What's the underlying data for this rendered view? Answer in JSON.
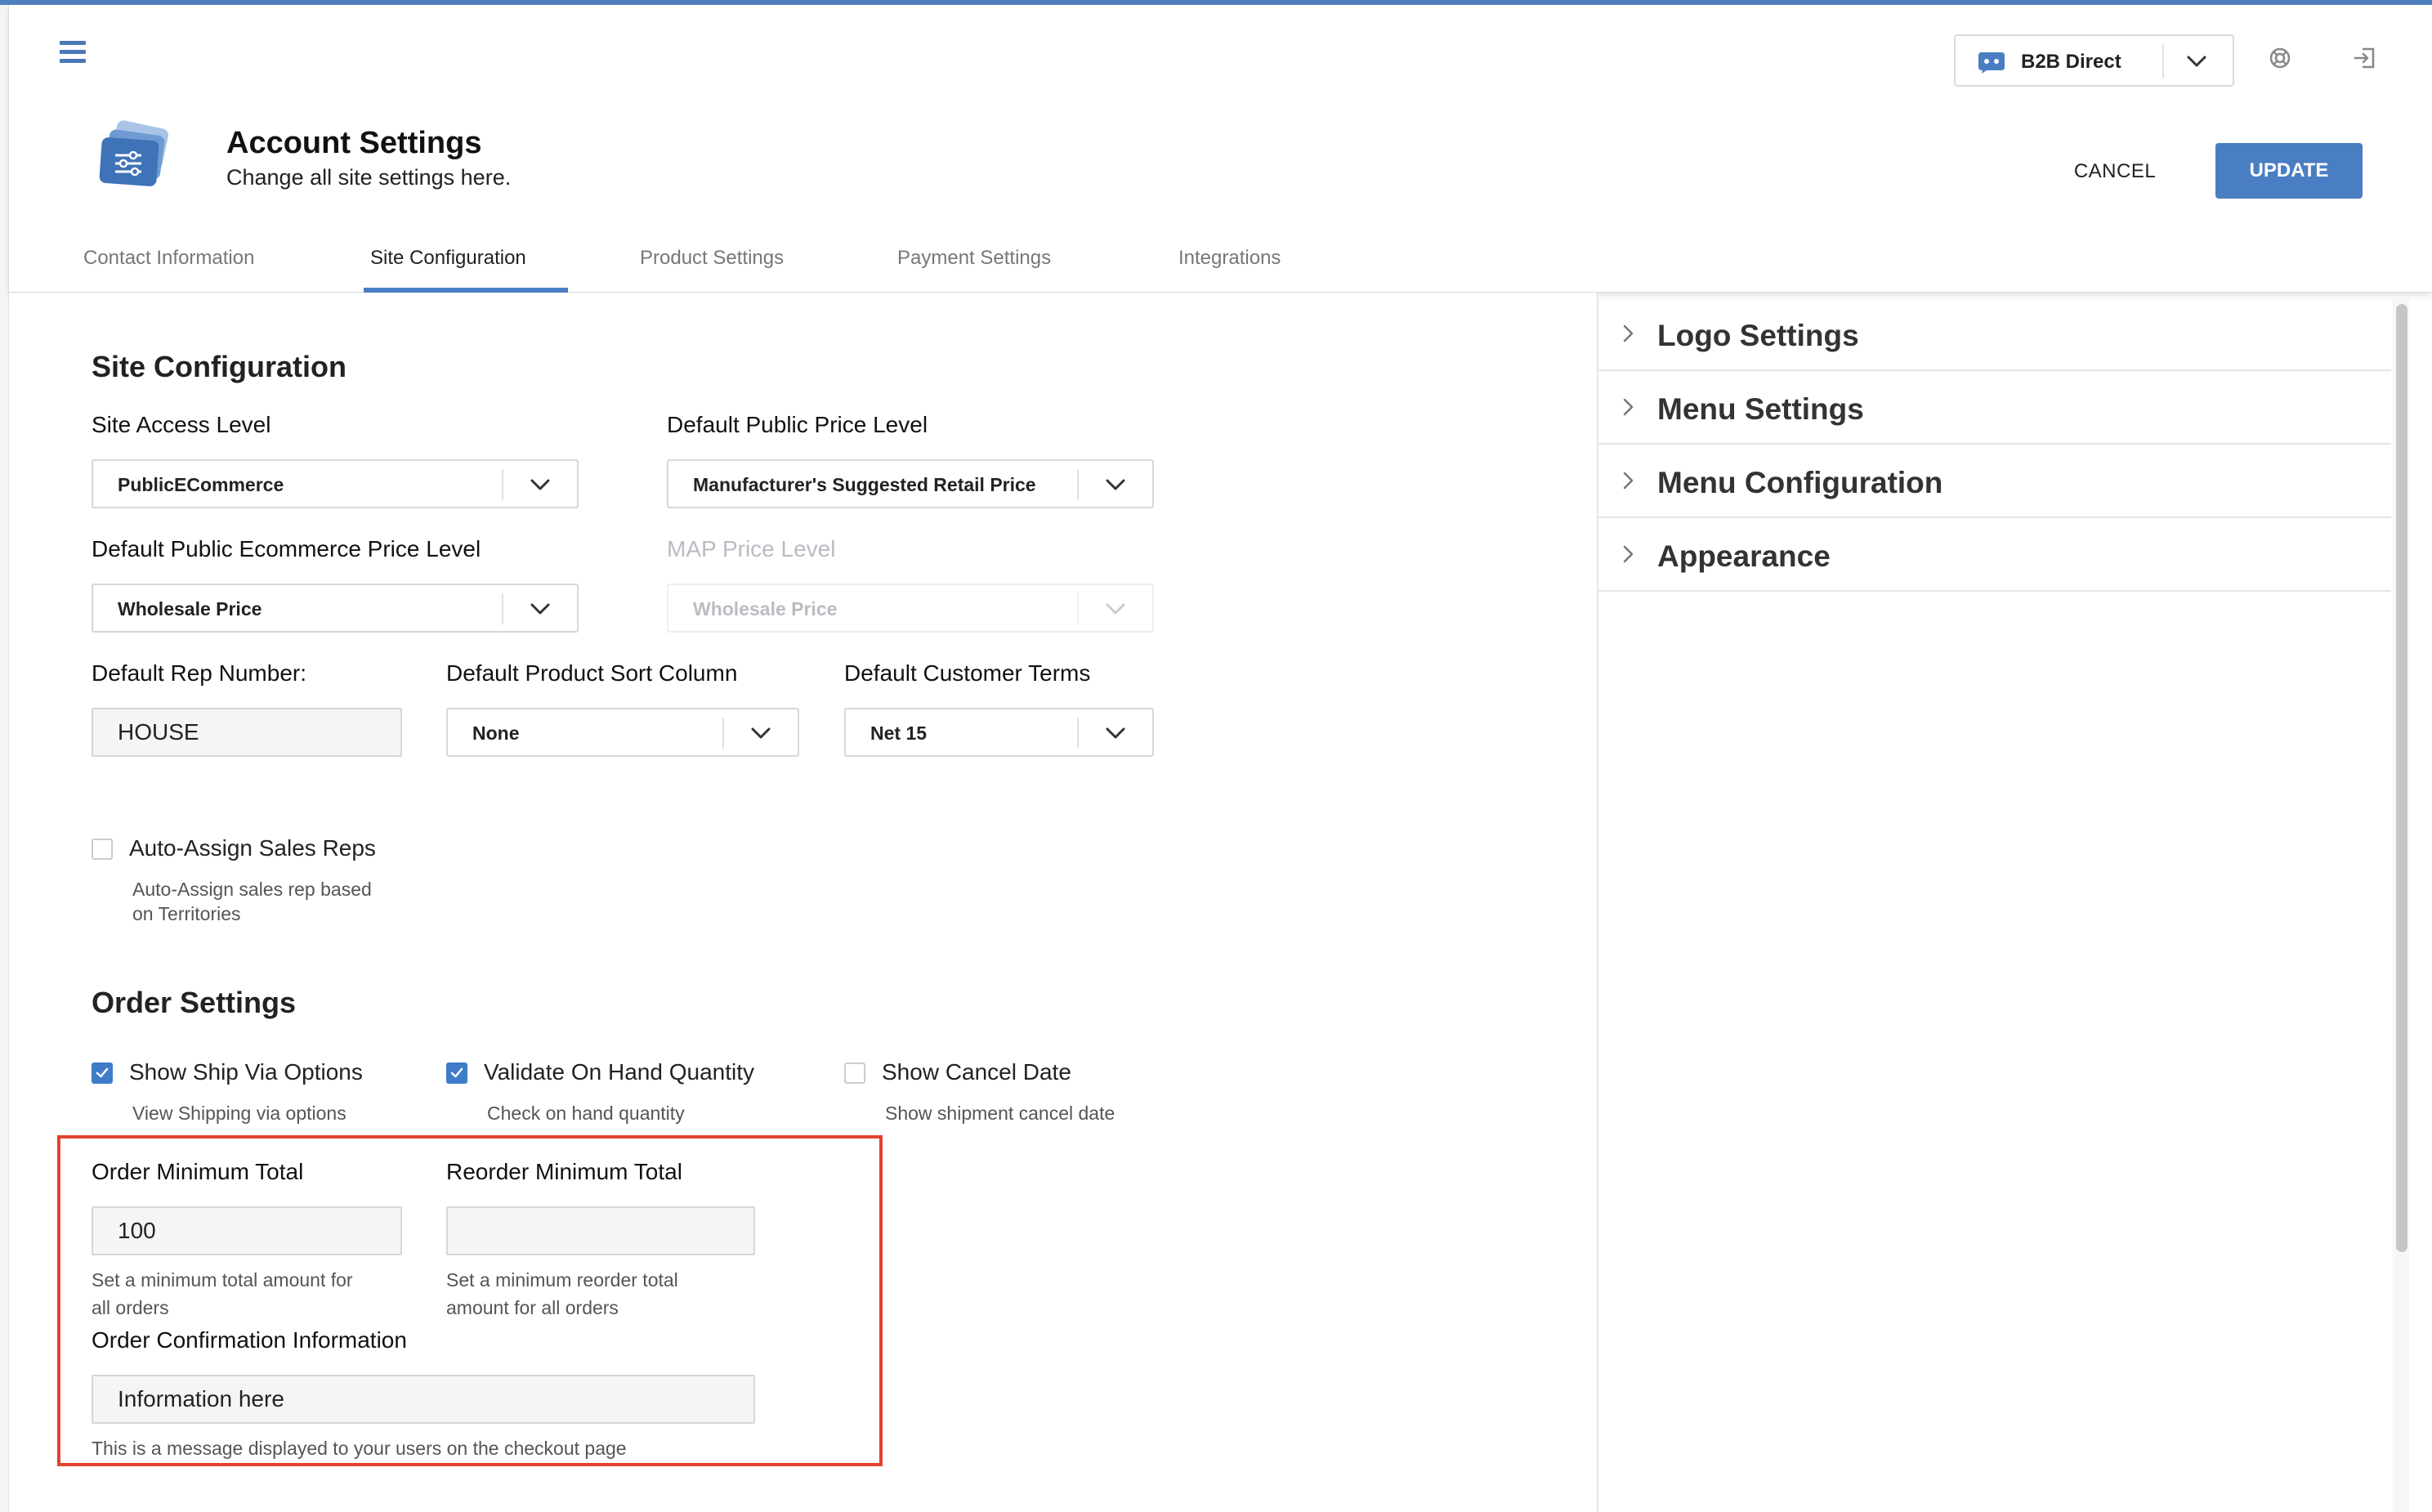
{
  "store": {
    "name": "B2B Direct"
  },
  "page": {
    "title": "Account Settings",
    "subtitle": "Change all site settings here."
  },
  "actions": {
    "cancel": "CANCEL",
    "update": "UPDATE"
  },
  "tabs": [
    {
      "label": "Contact Information"
    },
    {
      "label": "Site Configuration",
      "active": true
    },
    {
      "label": "Product Settings"
    },
    {
      "label": "Payment Settings"
    },
    {
      "label": "Integrations"
    }
  ],
  "site_config": {
    "title": "Site Configuration",
    "site_access_level": {
      "label": "Site Access Level",
      "value": "PublicECommerce"
    },
    "default_public_price_level": {
      "label": "Default Public Price Level",
      "value": "Manufacturer's Suggested Retail Price"
    },
    "default_public_ecommerce_price_level": {
      "label": "Default Public Ecommerce Price Level",
      "value": "Wholesale Price"
    },
    "map_price_level": {
      "label": "MAP Price Level",
      "value": "Wholesale Price",
      "disabled": true
    },
    "default_rep_number": {
      "label": "Default Rep Number:",
      "value": "HOUSE"
    },
    "default_product_sort_column": {
      "label": "Default Product Sort Column",
      "value": "None"
    },
    "default_customer_terms": {
      "label": "Default Customer Terms",
      "value": "Net 15"
    },
    "auto_assign": {
      "label": "Auto-Assign Sales Reps",
      "help_line1": "Auto-Assign sales rep based",
      "help_line2": "on Territories",
      "checked": false
    }
  },
  "order_settings": {
    "title": "Order Settings",
    "show_ship_via": {
      "label": "Show Ship Via Options",
      "help": "View Shipping via options",
      "checked": true
    },
    "validate_on_hand": {
      "label": "Validate On Hand Quantity",
      "help": "Check on hand quantity",
      "checked": true
    },
    "show_cancel_date": {
      "label": "Show Cancel Date",
      "help": "Show shipment cancel date",
      "checked": false
    },
    "order_minimum_total": {
      "label": "Order Minimum Total",
      "value": "100",
      "help_line1": "Set a minimum total amount for",
      "help_line2": "all orders"
    },
    "reorder_minimum_total": {
      "label": "Reorder Minimum Total",
      "value": "",
      "help_line1": "Set a minimum reorder total",
      "help_line2": "amount for all orders"
    },
    "order_confirmation_info": {
      "label": "Order Confirmation Information",
      "value": "Information here",
      "help": "This is a message displayed to your users on the checkout page"
    }
  },
  "side_panel": {
    "items": [
      {
        "title": "Logo Settings"
      },
      {
        "title": "Menu Settings"
      },
      {
        "title": "Menu Configuration"
      },
      {
        "title": "Appearance"
      }
    ]
  },
  "icons": {
    "menu": "hamburger-icon",
    "help": "help-icon",
    "logout": "logout-icon",
    "settings": "settings-cards-icon",
    "store": "store-logo-icon"
  },
  "colors": {
    "accent": "#4a7ec2",
    "highlight": "#e4412f"
  }
}
